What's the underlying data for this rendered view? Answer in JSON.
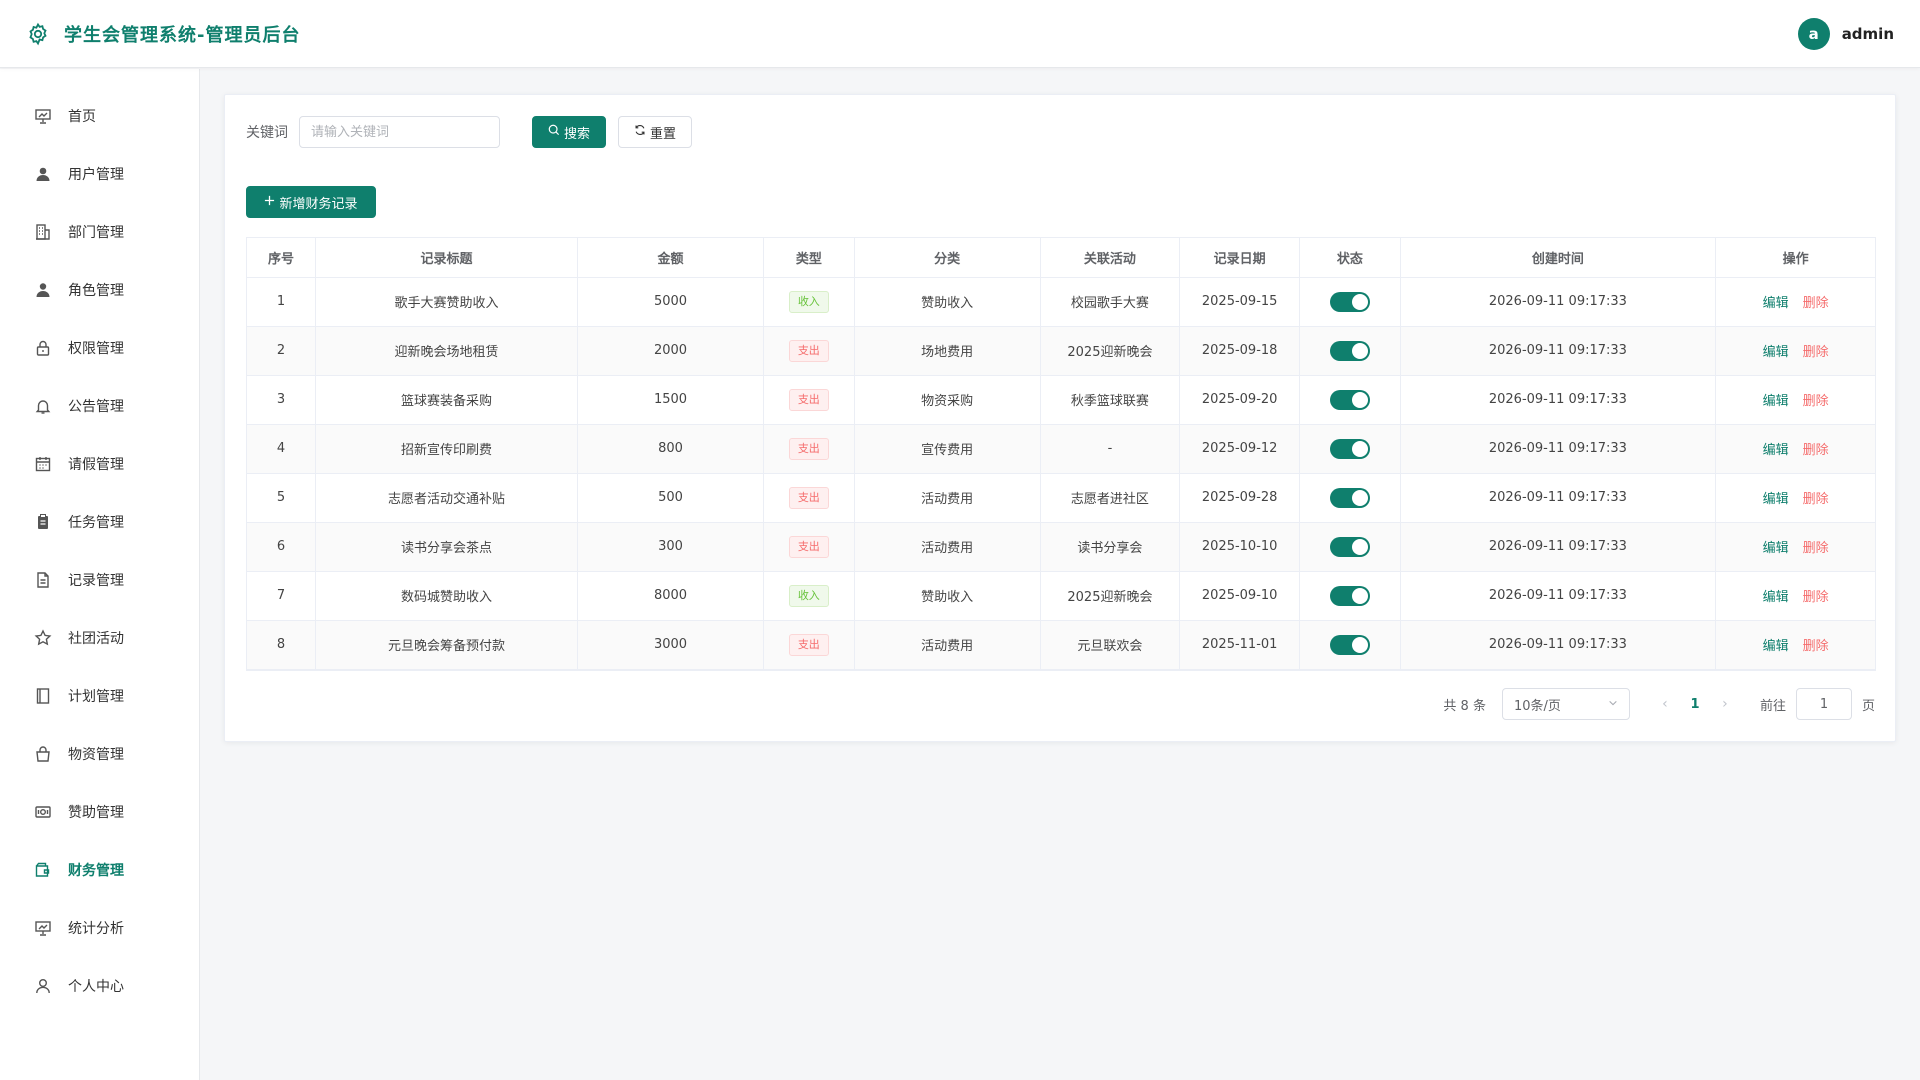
{
  "app": {
    "title": "学生会管理系统-管理员后台",
    "brand_color": "#0f7f6d",
    "user": {
      "avatar_letter": "a",
      "name": "admin"
    }
  },
  "sidebar": {
    "items": [
      {
        "label": "首页",
        "icon": "home-board-icon",
        "active": false
      },
      {
        "label": "用户管理",
        "icon": "user-icon",
        "active": false
      },
      {
        "label": "部门管理",
        "icon": "building-icon",
        "active": false
      },
      {
        "label": "角色管理",
        "icon": "user-role-icon",
        "active": false
      },
      {
        "label": "权限管理",
        "icon": "lock-icon",
        "active": false
      },
      {
        "label": "公告管理",
        "icon": "bell-icon",
        "active": false
      },
      {
        "label": "请假管理",
        "icon": "calendar-icon",
        "active": false
      },
      {
        "label": "任务管理",
        "icon": "clipboard-icon",
        "active": false
      },
      {
        "label": "记录管理",
        "icon": "document-icon",
        "active": false
      },
      {
        "label": "社团活动",
        "icon": "star-icon",
        "active": false
      },
      {
        "label": "计划管理",
        "icon": "notebook-icon",
        "active": false
      },
      {
        "label": "物资管理",
        "icon": "bag-icon",
        "active": false
      },
      {
        "label": "赞助管理",
        "icon": "money-icon",
        "active": false
      },
      {
        "label": "财务管理",
        "icon": "wallet-icon",
        "active": true
      },
      {
        "label": "统计分析",
        "icon": "chart-board-icon",
        "active": false
      },
      {
        "label": "个人中心",
        "icon": "person-icon",
        "active": false
      }
    ]
  },
  "search": {
    "label": "关键词",
    "placeholder": "请输入关键词",
    "search_button": "搜索",
    "reset_button": "重置"
  },
  "toolbar": {
    "add_button": "新增财务记录"
  },
  "table": {
    "columns": [
      "序号",
      "记录标题",
      "金额",
      "类型",
      "分类",
      "关联活动",
      "记录日期",
      "状态",
      "创建时间",
      "操作"
    ],
    "edit_label": "编辑",
    "delete_label": "删除",
    "rows": [
      {
        "no": "1",
        "title": "歌手大赛赞助收入",
        "amount": "5000",
        "type": "收入",
        "category": "赞助收入",
        "activity": "校园歌手大赛",
        "date": "2025-09-15",
        "enabled": true,
        "created": "2026-09-11 09:17:33"
      },
      {
        "no": "2",
        "title": "迎新晚会场地租赁",
        "amount": "2000",
        "type": "支出",
        "category": "场地费用",
        "activity": "2025迎新晚会",
        "date": "2025-09-18",
        "enabled": true,
        "created": "2026-09-11 09:17:33"
      },
      {
        "no": "3",
        "title": "篮球赛装备采购",
        "amount": "1500",
        "type": "支出",
        "category": "物资采购",
        "activity": "秋季篮球联赛",
        "date": "2025-09-20",
        "enabled": true,
        "created": "2026-09-11 09:17:33"
      },
      {
        "no": "4",
        "title": "招新宣传印刷费",
        "amount": "800",
        "type": "支出",
        "category": "宣传费用",
        "activity": "-",
        "date": "2025-09-12",
        "enabled": true,
        "created": "2026-09-11 09:17:33"
      },
      {
        "no": "5",
        "title": "志愿者活动交通补贴",
        "amount": "500",
        "type": "支出",
        "category": "活动费用",
        "activity": "志愿者进社区",
        "date": "2025-09-28",
        "enabled": true,
        "created": "2026-09-11 09:17:33"
      },
      {
        "no": "6",
        "title": "读书分享会茶点",
        "amount": "300",
        "type": "支出",
        "category": "活动费用",
        "activity": "读书分享会",
        "date": "2025-10-10",
        "enabled": true,
        "created": "2026-09-11 09:17:33"
      },
      {
        "no": "7",
        "title": "数码城赞助收入",
        "amount": "8000",
        "type": "收入",
        "category": "赞助收入",
        "activity": "2025迎新晚会",
        "date": "2025-09-10",
        "enabled": true,
        "created": "2026-09-11 09:17:33"
      },
      {
        "no": "8",
        "title": "元旦晚会筹备预付款",
        "amount": "3000",
        "type": "支出",
        "category": "活动费用",
        "activity": "元旦联欢会",
        "date": "2025-11-01",
        "enabled": true,
        "created": "2026-09-11 09:17:33"
      }
    ]
  },
  "pagination": {
    "total_text": "共 8 条",
    "page_size": "10条/页",
    "current_page": "1",
    "goto_label": "前往",
    "goto_value": "1",
    "page_suffix": "页"
  }
}
